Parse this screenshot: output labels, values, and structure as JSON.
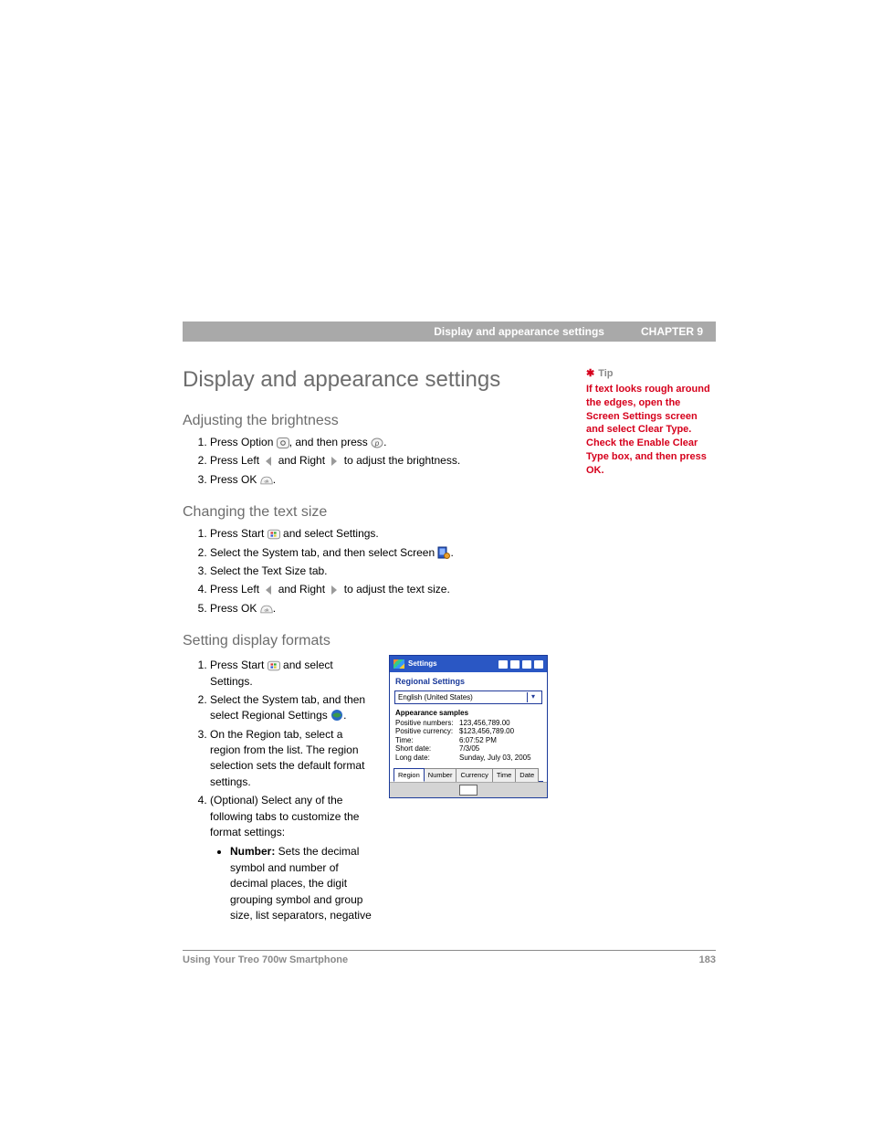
{
  "header": {
    "section": "Display and appearance settings",
    "chapter": "CHAPTER 9"
  },
  "title": "Display and appearance settings",
  "sections": {
    "brightness": {
      "heading": "Adjusting the brightness",
      "step1_a": "Press Option ",
      "step1_b": ", and then press ",
      "step1_c": ".",
      "step2_a": "Press Left ",
      "step2_b": " and Right ",
      "step2_c": " to adjust the brightness.",
      "step3_a": "Press OK ",
      "step3_b": "."
    },
    "textsize": {
      "heading": "Changing the text size",
      "step1_a": "Press Start ",
      "step1_b": " and select Settings.",
      "step2_a": "Select the System tab, and then select Screen ",
      "step2_b": ".",
      "step3": "Select the Text Size tab.",
      "step4_a": "Press Left ",
      "step4_b": " and Right ",
      "step4_c": " to adjust the text size.",
      "step5_a": "Press OK ",
      "step5_b": "."
    },
    "formats": {
      "heading": "Setting display formats",
      "step1_a": "Press Start ",
      "step1_b": " and select Settings.",
      "step2_a": "Select the System tab, and then select Regional Settings ",
      "step2_b": ".",
      "step3": "On the Region tab, select a region from the list. The region selection sets the default format settings.",
      "step4": "(Optional) Select any of the following tabs to customize the format settings:",
      "bullet1_label": "Number:",
      "bullet1_text": " Sets the decimal symbol and number of decimal places, the digit grouping symbol and group size, list separators, negative"
    }
  },
  "tip": {
    "label": "Tip",
    "text": "If text looks rough around the edges, open the Screen Settings screen and select Clear Type. Check the Enable Clear Type box, and then press OK."
  },
  "screenshot": {
    "titlebar": "Settings",
    "heading": "Regional Settings",
    "dropdown": "English (United States)",
    "samples_label": "Appearance samples",
    "rows": {
      "r1k": "Positive numbers:",
      "r1v": "123,456,789.00",
      "r2k": "Positive currency:",
      "r2v": "$123,456,789.00",
      "r3k": "Time:",
      "r3v": "6:07:52 PM",
      "r4k": "Short date:",
      "r4v": "7/3/05",
      "r5k": "Long date:",
      "r5v": "Sunday, July 03, 2005"
    },
    "tabs": {
      "t1": "Region",
      "t2": "Number",
      "t3": "Currency",
      "t4": "Time",
      "t5": "Date"
    }
  },
  "footer": {
    "left": "Using Your Treo 700w Smartphone",
    "page": "183"
  }
}
